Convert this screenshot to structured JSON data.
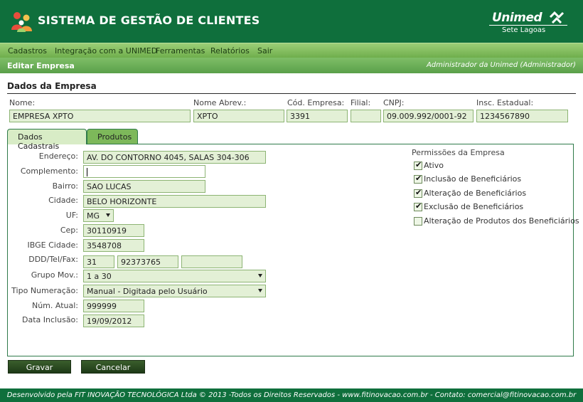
{
  "header": {
    "app_title": "SISTEMA DE GESTÃO DE CLIENTES",
    "brand_name": "Unimed",
    "brand_sub": "Sete Lagoas"
  },
  "menu": [
    "Cadastros",
    "Integração com a UNIMED",
    "Ferramentas",
    "Relatórios",
    "Sair"
  ],
  "titlebar": {
    "page_title": "Editar Empresa",
    "user_info": "Administrador da Unimed (Administrador)"
  },
  "section_title": "Dados da Empresa",
  "empresa": {
    "nome_label": "Nome:",
    "nome": "EMPRESA XPTO",
    "nome_abrev_label": "Nome Abrev.:",
    "nome_abrev": "XPTO",
    "cod_label": "Cód. Empresa:",
    "cod": "3391",
    "filial_label": "Filial:",
    "filial": "",
    "cnpj_label": "CNPJ:",
    "cnpj": "09.009.992/0001-92",
    "insc_label": "Insc. Estadual:",
    "insc": "1234567890"
  },
  "tabs": [
    "Dados Cadastrais",
    "Produtos"
  ],
  "cadastro": {
    "endereco_label": "Endereço:",
    "endereco": "AV. DO CONTORNO 4045, SALAS 304-306",
    "complemento_label": "Complemento:",
    "complemento": "",
    "bairro_label": "Bairro:",
    "bairro": "SAO LUCAS",
    "cidade_label": "Cidade:",
    "cidade": "BELO HORIZONTE",
    "uf_label": "UF:",
    "uf": "MG",
    "cep_label": "Cep:",
    "cep": "30110919",
    "ibge_label": "IBGE Cidade:",
    "ibge": "3548708",
    "tel_label": "DDD/Tel/Fax:",
    "ddd": "31",
    "tel": "92373765",
    "fax": "",
    "grupo_label": "Grupo Mov.:",
    "grupo": "1 a 30",
    "tipo_label": "Tipo Numeração:",
    "tipo": "Manual - Digitada pelo Usuário",
    "num_label": "Núm. Atual:",
    "num": "999999",
    "data_label": "Data Inclusão:",
    "data": "19/09/2012"
  },
  "permissoes": {
    "title": "Permissões da Empresa",
    "items": [
      {
        "label": "Ativo",
        "checked": true
      },
      {
        "label": "Inclusão de Beneficiários",
        "checked": true
      },
      {
        "label": "Alteração de Beneficiários",
        "checked": true
      },
      {
        "label": "Exclusão de Beneficiários",
        "checked": true
      },
      {
        "label": "Alteração de Produtos dos Beneficiários",
        "checked": false
      }
    ]
  },
  "buttons": {
    "save": "Gravar",
    "cancel": "Cancelar"
  },
  "footer": "Desenvolvido pela FIT INOVAÇÃO TECNOLÓGICA Ltda © 2013 -Todos os Direitos Reservados - www.fitinovacao.com.br - Contato: comercial@fitinovacao.com.br",
  "colors": {
    "brand_green": "#0f6f3c",
    "menu_green": "#7fbe67",
    "field_bg": "#e3f0d6"
  }
}
